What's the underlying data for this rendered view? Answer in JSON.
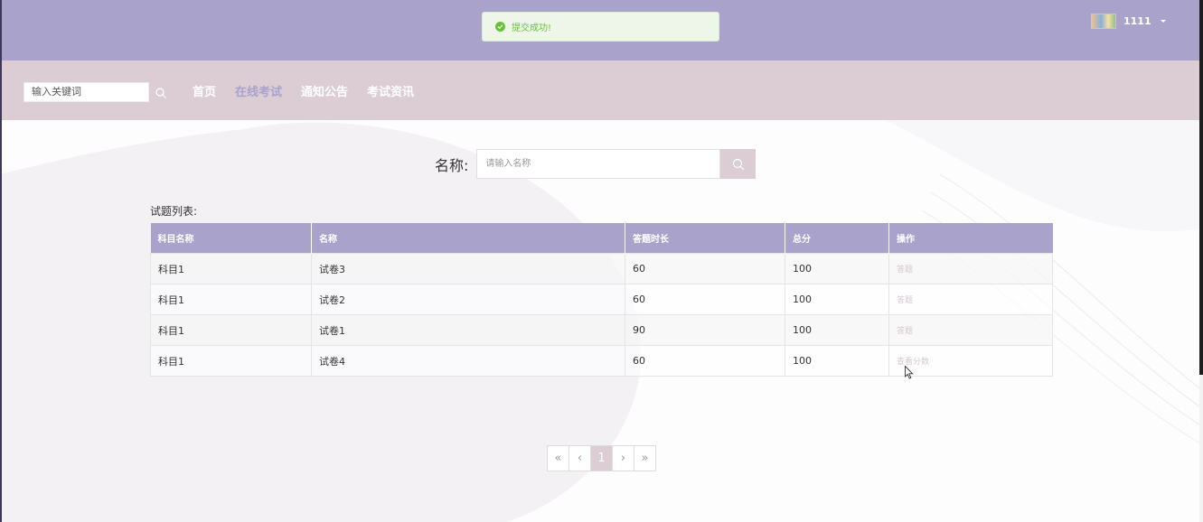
{
  "toast": {
    "message": "提交成功!",
    "color": "#67c23a"
  },
  "user": {
    "name": "1111"
  },
  "nav": {
    "search_placeholder": "输入关键词",
    "links": [
      {
        "label": "首页"
      },
      {
        "label": "在线考试"
      },
      {
        "label": "通知公告"
      },
      {
        "label": "考试资讯"
      }
    ],
    "active_index": 1
  },
  "search": {
    "label": "名称:",
    "placeholder": "请输入名称"
  },
  "list": {
    "caption": "试题列表:",
    "headers": [
      "科目名称",
      "名称",
      "答题时长",
      "总分",
      "操作"
    ],
    "rows": [
      {
        "subject": "科目1",
        "name": "试卷3",
        "duration": "60",
        "score": "100",
        "action": "答题"
      },
      {
        "subject": "科目1",
        "name": "试卷2",
        "duration": "60",
        "score": "100",
        "action": "答题"
      },
      {
        "subject": "科目1",
        "name": "试卷1",
        "duration": "90",
        "score": "100",
        "action": "答题"
      },
      {
        "subject": "科目1",
        "name": "试卷4",
        "duration": "60",
        "score": "100",
        "action": "查看分数"
      }
    ]
  },
  "pagination": {
    "first": "«",
    "prev": "‹",
    "current": "1",
    "next": "›",
    "last": "»"
  },
  "colors": {
    "primary": "#a9a3cc",
    "secondary": "#dbcdd3",
    "success": "#67c23a"
  }
}
